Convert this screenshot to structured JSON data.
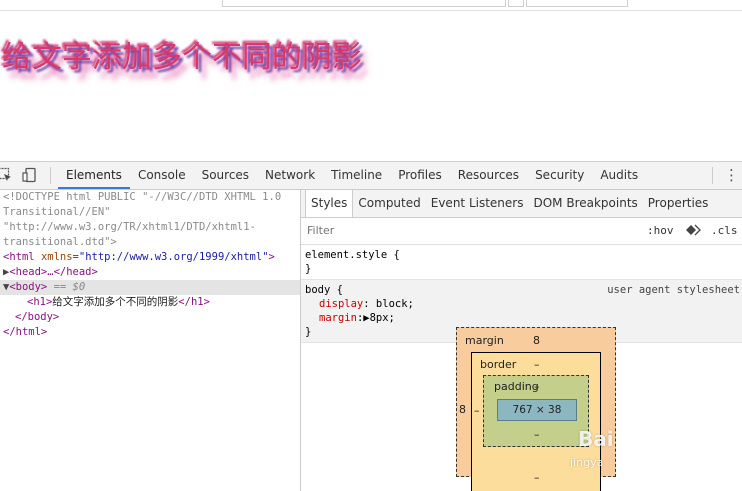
{
  "page": {
    "headline": "给文字添加多个不同的阴影"
  },
  "devtools": {
    "tabs": [
      "Elements",
      "Console",
      "Sources",
      "Network",
      "Timeline",
      "Profiles",
      "Resources",
      "Security",
      "Audits"
    ],
    "active_tab": "Elements",
    "dom": {
      "doctype_1": "<!DOCTYPE html PUBLIC \"-//W3C//DTD XHTML 1.0",
      "doctype_2": "Transitional//EN\"",
      "doctype_3": "\"http://www.w3.org/TR/xhtml1/DTD/xhtml1-",
      "doctype_4": "transitional.dtd\">",
      "html_open": "<html ",
      "html_attr_name": "xmlns",
      "html_attr_eq": "=",
      "html_attr_value": "\"http://www.w3.org/1999/xhtml\"",
      "html_close_bracket": ">",
      "head_arrow": "▶",
      "head_text": "<head>…</head>",
      "body_arrow": "▼",
      "body_open": "<body>",
      "body_marker": " == $0",
      "h1_open": "<h1>",
      "h1_text": "给文字添加多个不同的阴影",
      "h1_close": "</h1>",
      "body_close": "</body>",
      "html_close": "</html>"
    },
    "styles": {
      "subtabs": [
        "Styles",
        "Computed",
        "Event Listeners",
        "DOM Breakpoints",
        "Properties"
      ],
      "active_subtab": "Styles",
      "filter_placeholder": "Filter",
      "hov": ":hov",
      "cls": ".cls",
      "element_style_selector": "element.style {",
      "element_style_close": "}",
      "body_rule": {
        "selector": "body {",
        "source": "user agent stylesheet",
        "props": [
          {
            "name": "display",
            "colon": ": ",
            "value": "block;"
          },
          {
            "name": "margin",
            "colon": ":",
            "value": "▶8px;"
          }
        ],
        "close": "}"
      },
      "box_model": {
        "margin_label": "margin",
        "margin_top": "8",
        "margin_left": "8",
        "border_label": "border",
        "border_top": "–",
        "border_left": "–",
        "padding_label": "padding",
        "padding_top": "–",
        "padding_bottom": "–",
        "border_bottom": "–",
        "content_size": "767 × 38"
      }
    }
  },
  "watermark": {
    "brand": "Bai",
    "sub": "jingya"
  },
  "colors": {
    "headline": "#d63a6b",
    "shadow_purple": "#6d3fa8",
    "shadow_pink": "#e86fb0",
    "active_tab_underline": "#3879d9",
    "box_margin": "#f9cc9d",
    "box_border": "#fddd9b",
    "box_padding": "#c3cf8a",
    "box_content": "#8cb6c0"
  }
}
